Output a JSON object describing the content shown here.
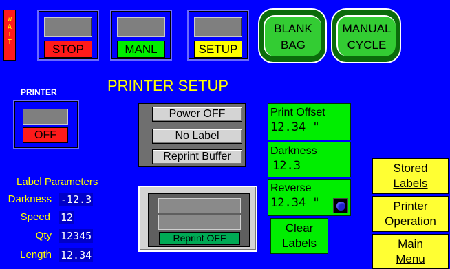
{
  "wait_indicator": {
    "letters": "W A I T"
  },
  "controls": {
    "stop_label": "STOP",
    "manl_label": "MANL",
    "setup_label": "SETUP",
    "blank_bag_label": [
      "BLANK",
      "BAG"
    ],
    "manual_cycle_label": [
      "MANUAL",
      "CYCLE"
    ]
  },
  "page_title": "PRINTER SETUP",
  "printer": {
    "heading": "PRINTER",
    "state_label": "OFF"
  },
  "printer_actions": {
    "power_off": "Power OFF",
    "no_label": "No Label",
    "reprint_buffer": "Reprint Buffer"
  },
  "reprint": {
    "button_label": "Reprint OFF"
  },
  "label_parameters": {
    "title": "Label Parameters",
    "rows": [
      {
        "label": "Darkness",
        "value": "-12.3"
      },
      {
        "label": "Speed",
        "value": "12"
      },
      {
        "label": "Qty",
        "value": "12345"
      },
      {
        "label": "Length",
        "value": "12.34"
      }
    ]
  },
  "settings": {
    "print_offset": {
      "label": "Print Offset",
      "value": "12.34 \""
    },
    "darkness": {
      "label": "Darkness",
      "value": "12.3"
    },
    "reverse": {
      "label": "Reverse",
      "value": "12.34 \""
    },
    "clear_labels": [
      "Clear",
      "Labels"
    ]
  },
  "nav": {
    "stored_labels": [
      "Stored",
      "Labels"
    ],
    "printer_operation": [
      "Printer",
      "Operation"
    ],
    "main_menu": [
      "Main",
      "Menu"
    ]
  },
  "colors": {
    "background": "#0000ff",
    "stop": "#ff1a1a",
    "manl": "#00ee00",
    "setup": "#ffff00",
    "title": "#ffff00"
  }
}
